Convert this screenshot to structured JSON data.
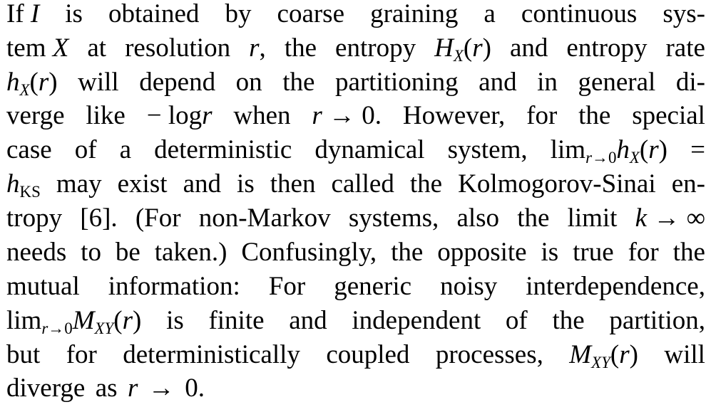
{
  "paragraph": {
    "lines": [
      "If I is obtained by coarse graining a continuous sys-",
      "tem X at resolution r, the entropy H_X(r) and entropy rate",
      "h_X(r) will depend on the partitioning and in general di-",
      "verge like − log r when r → 0. However, for the special",
      "case of a deterministic dynamical system, lim_{r→0} h_X(r) =",
      "h_KS may exist and is then called the Kolmogorov-Sinai en-",
      "tropy [6]. (For non-Markov systems, also the limit k → ∞",
      "needs to be taken.) Confusingly, the opposite is true for the",
      "mutual information: For generic noisy interdependence,",
      "lim_{r→0} M_XY(r) is finite and independent of the partition,",
      "but for deterministically coupled processes, M_XY(r) will",
      "diverge as r → 0."
    ]
  }
}
